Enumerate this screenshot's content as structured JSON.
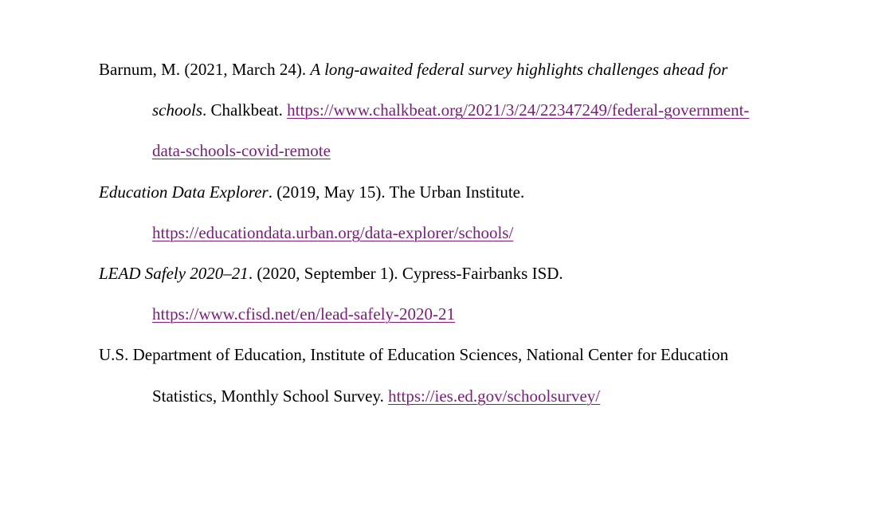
{
  "references": [
    {
      "part1": "Barnum, M. (2021, March 24). ",
      "title_line1": "A long-awaited federal survey highlights challenges ahead for",
      "title_line2": "schools",
      "part2": ". Chalkbeat. ",
      "url_line1": "https://www.chalkbeat.org/2021/3/24/22347249/federal-government-",
      "url_line2": "data-schools-covid-remote"
    },
    {
      "title": "Education Data Explorer",
      "part1": ". (2019, May 15). The Urban Institute.",
      "url": "https://educationdata.urban.org/data-explorer/schools/"
    },
    {
      "title": "LEAD Safely 2020–21",
      "part1": ". (2020, September 1). Cypress-Fairbanks ISD.",
      "url": "https://www.cfisd.net/en/lead-safely-2020-21"
    },
    {
      "line1": "U.S. Department of Education, Institute of Education Sciences, National Center for Education",
      "line2": "Statistics, Monthly School Survey. ",
      "url": "https://ies.ed.gov/schoolsurvey/"
    }
  ],
  "colors": {
    "text": "#000000",
    "link": "#7a1d7a"
  }
}
